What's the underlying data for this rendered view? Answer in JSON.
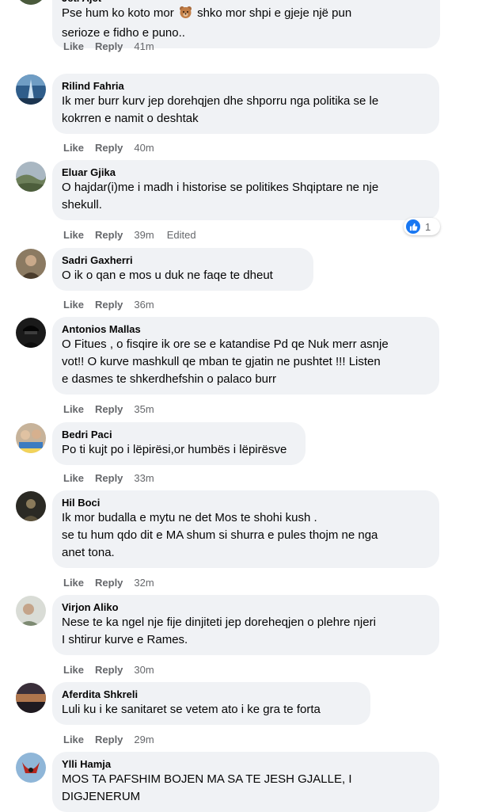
{
  "theme": {
    "bubble": "#f0f2f5",
    "link_blue": "#1877f2",
    "meta_gray": "#65676b",
    "text": "#050505"
  },
  "actions": {
    "like": "Like",
    "reply": "Reply"
  },
  "comments": [
    {
      "author": "Jeti Ajet",
      "avatar": "avatar-landscape",
      "lines": [
        "Pse hum ko koto mor {emoji} shko mor shpi e gjeje një pun",
        "serioze e fidho e puno.."
      ],
      "emoji": "bear-face-icon",
      "time": "41m"
    },
    {
      "author": "Rilind Fahria",
      "avatar": "avatar-blue-tower",
      "lines": [
        "Ik mer burr kurv jep dorehqjen dhe shporru nga politika se le",
        "kokrren e namit o deshtak"
      ],
      "time": "40m"
    },
    {
      "author": "Eluar Gjika",
      "avatar": "avatar-hillside",
      "lines": [
        "O hajdar(i)me i madh i historise se politikes Shqiptare ne nje",
        "shekull."
      ],
      "time": "39m",
      "edited": "Edited",
      "reaction_count": "1"
    },
    {
      "author": "Sadri Gaxherri",
      "avatar": "avatar-portrait-brown",
      "lines": [
        "O ik o qan e mos u duk ne faqe te dheut"
      ],
      "time": "36m"
    },
    {
      "author": "Antonios Mallas",
      "avatar": "avatar-dark-cap",
      "lines": [
        "O Fitues , o fisqire ik ore se e katandise Pd qe Nuk merr asnje",
        "vot!! O kurve mashkull qe mban te gjatin ne pushtet !!! Listen",
        "e dasmes te shkerdhefshin o palaco burr"
      ],
      "time": "35m"
    },
    {
      "author": "Bedri Paci",
      "avatar": "avatar-group-photo",
      "lines": [
        "Po ti kujt po i lëpirësi,or humbës i lëpirësve"
      ],
      "time": "33m"
    },
    {
      "author": "Hil Boci",
      "avatar": "avatar-dark-scene",
      "lines": [
        "Ik mor budalla e mytu ne det Mos te shohi kush .",
        "se tu hum qdo dit e MA shum si shurra e pules thojm ne nga",
        "anet tona."
      ],
      "time": "32m"
    },
    {
      "author": "Virjon Aliko",
      "avatar": "avatar-light-portrait",
      "lines": [
        "Nese te ka ngel nje fije dinjiteti jep doreheqjen o plehre njeri",
        "I shtirur kurve e Rames."
      ],
      "time": "30m"
    },
    {
      "author": "Aferdita Shkreli",
      "avatar": "avatar-sunset",
      "lines": [
        "Luli ku i ke sanitaret se vetem ato i ke gra te forta"
      ],
      "time": "29m"
    },
    {
      "author": "Ylli Hamja",
      "avatar": "avatar-eagle-flag",
      "lines": [
        "MOS TA PAFSHIM BOJEN MA SA TE JESH GJALLE, I",
        "DIGJENERUM"
      ]
    }
  ]
}
